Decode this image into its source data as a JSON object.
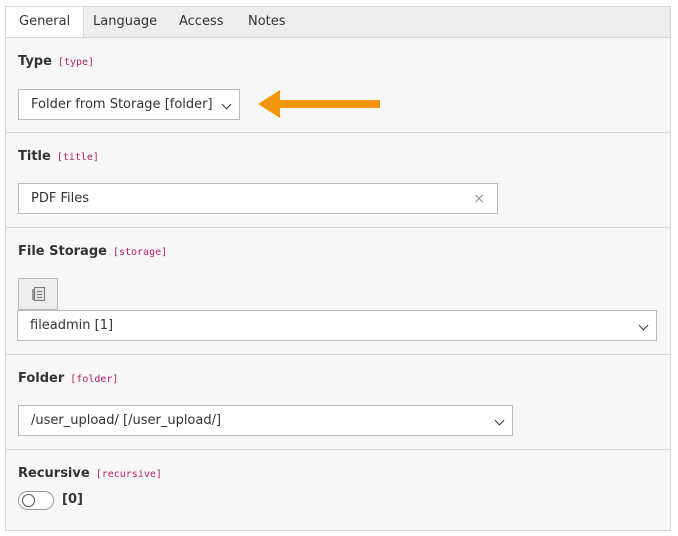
{
  "tabs": [
    "General",
    "Language",
    "Access",
    "Notes"
  ],
  "fields": {
    "type": {
      "label": "Type",
      "code": "[type]",
      "value": "Folder from Storage [folder]"
    },
    "title": {
      "label": "Title",
      "code": "[title]",
      "value": "PDF Files",
      "clear": "×"
    },
    "storage": {
      "label": "File Storage",
      "code": "[storage]",
      "value": "fileadmin [1]"
    },
    "folder": {
      "label": "Folder",
      "code": "[folder]",
      "value": "/user_upload/ [/user_upload/]"
    },
    "recursive": {
      "label": "Recursive",
      "code": "[recursive]",
      "value": "[0]",
      "checked": false
    }
  },
  "colors": {
    "accent_arrow": "#f0960a",
    "code_text": "#b61f6c",
    "panel_bg": "#f7f7f7",
    "tab_bar_bg": "#eeeeee"
  },
  "icons": {
    "storage_edit": "document-icon",
    "type_pointer": "arrow-left-icon"
  }
}
